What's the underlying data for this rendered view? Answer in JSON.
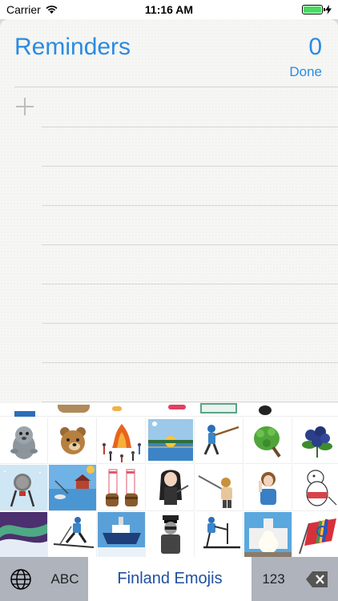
{
  "status_bar": {
    "carrier": "Carrier",
    "time": "11:16 AM",
    "battery_color": "#4cd964"
  },
  "reminders": {
    "title": "Reminders",
    "count": "0",
    "done_label": "Done",
    "accent_color": "#2b8be0"
  },
  "keyboard": {
    "globe_icon": "globe-icon",
    "abc_label": "ABC",
    "keyboard_name": "Finland Emojis",
    "num_label": "123",
    "delete_icon": "backspace-icon",
    "stickers": [
      [
        "seal",
        "bear-face",
        "bonfire-dancers",
        "lake-sunset",
        "baseball-batter",
        "birch-whisk",
        "blueberries"
      ],
      [
        "sauna-stove",
        "ice-fishing",
        "wool-socks-sandals",
        "rocker-woman",
        "javelin-thrower",
        "woman-finger-wag",
        "moomin"
      ],
      [
        "northern-lights",
        "cross-country-skier",
        "icebreaker-ship",
        "biker-man",
        "kicksled-rider",
        "polar-bear-cathedral",
        "sami-flag"
      ]
    ]
  }
}
